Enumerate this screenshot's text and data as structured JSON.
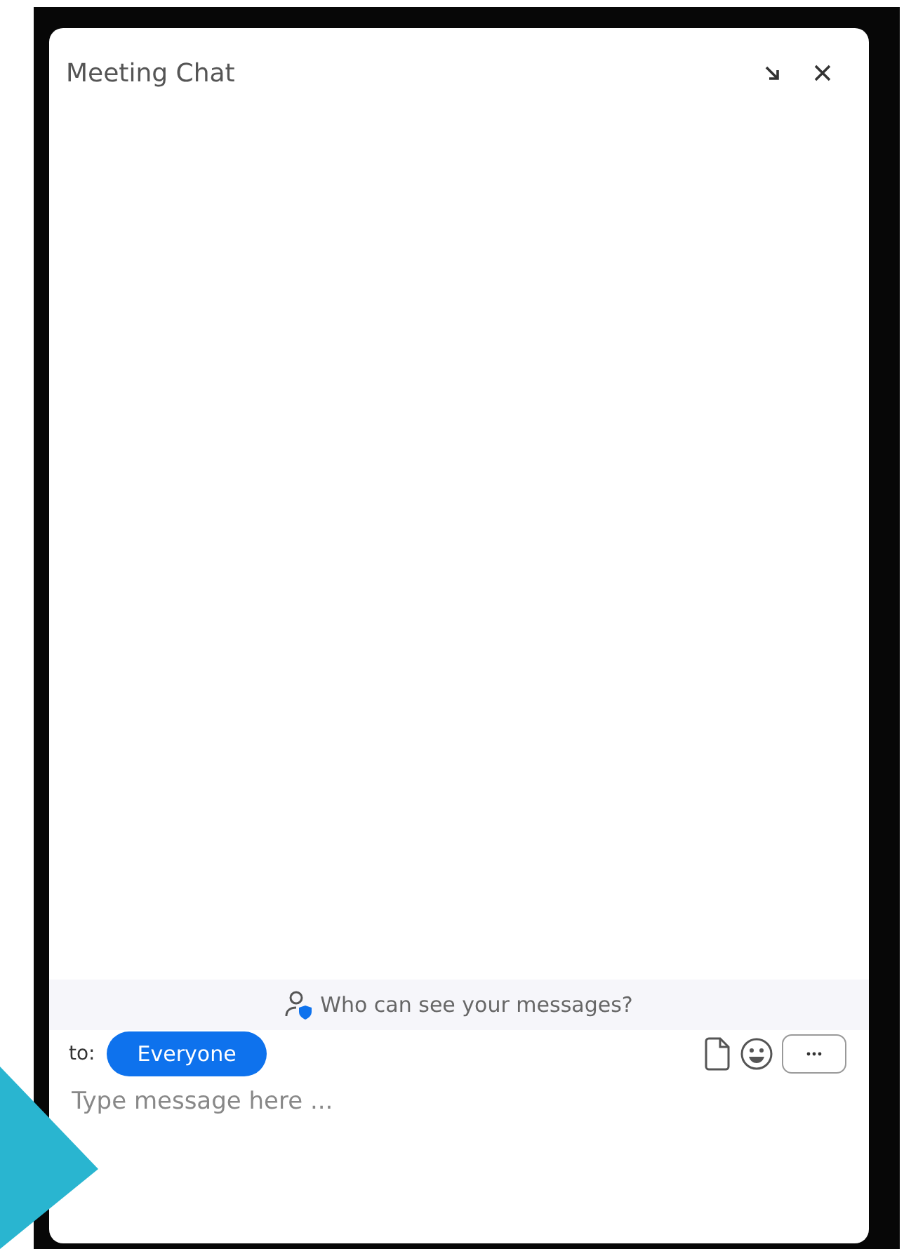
{
  "window": {
    "title": "Meeting Chat"
  },
  "privacy_notice": "Who can see your messages?",
  "recipient": {
    "label": "to:",
    "value": "Everyone"
  },
  "composer": {
    "placeholder": "Type message here ..."
  }
}
